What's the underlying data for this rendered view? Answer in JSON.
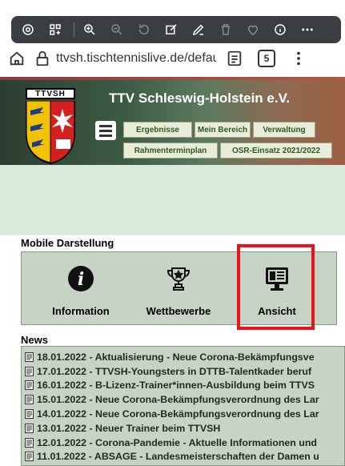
{
  "browser": {
    "url": "ttvsh.tischtennislive.de/default.a",
    "tab_count": "5"
  },
  "site": {
    "crest_label": "TTVSH",
    "title": "TTV Schleswig-Holstein e.V.",
    "nav_row1": [
      "Ergebnisse",
      "Mein Bereich",
      "Verwaltung"
    ],
    "nav_row2": [
      "Rahmenterminplan",
      "OSR-Einsatz 2021/2022"
    ]
  },
  "mobile": {
    "title": "Mobile Darstellung",
    "tiles": [
      {
        "label": "Information",
        "icon": "info-icon"
      },
      {
        "label": "Wettbewerbe",
        "icon": "trophy-icon"
      },
      {
        "label": "Ansicht",
        "icon": "monitor-icon"
      }
    ]
  },
  "news": {
    "title": "News",
    "items": [
      "18.01.2022 - Aktualisierung - Neue Corona-Bekämpfungsve",
      "17.01.2022 - TTVSH-Youngsters in DTTB-Talentkader beruf",
      "16.01.2022 - B-Lizenz-Trainer*innen-Ausbildung beim TTVS",
      "15.01.2022 - Neue Corona-Bekämpfungsverordnung des Lar",
      "14.01.2022 - Neue Corona-Bekämpfungsverordnung des Lar",
      "13.01.2022 - Neuer Trainer beim TTVSH",
      "12.01.2022 - Corona-Pandemie - Aktuelle Informationen und",
      "11.01.2022 - ABSAGE - Landesmeisterschaften der Damen u"
    ]
  },
  "colors": {
    "highlight": "#e8131b",
    "nav_text": "#2f5a1f",
    "panel_bg": "#c7d4c5",
    "band_bg": "#d9eadd"
  }
}
